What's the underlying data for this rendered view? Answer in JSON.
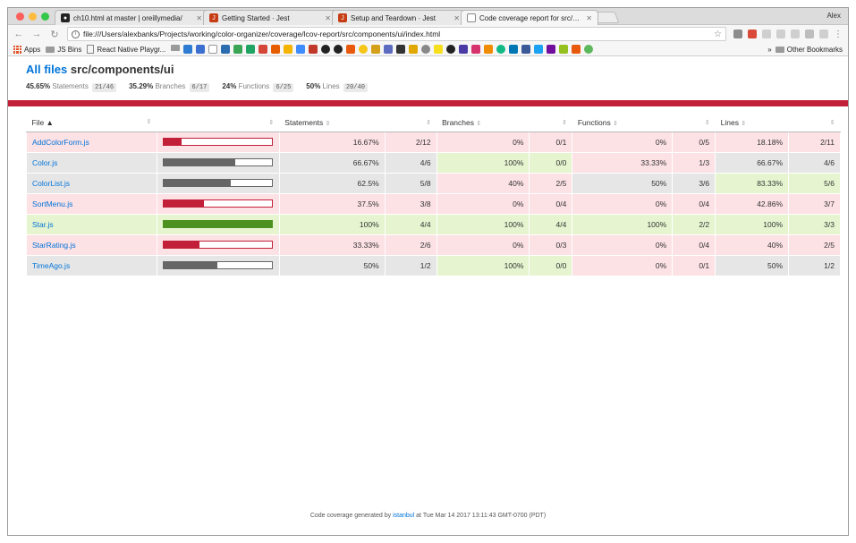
{
  "browser": {
    "user": "Alex",
    "tabs": [
      {
        "title": "ch10.html at master | oreillymedia/",
        "favicon": "github-icon"
      },
      {
        "title": "Getting Started · Jest",
        "favicon": "jest-icon"
      },
      {
        "title": "Setup and Teardown · Jest",
        "favicon": "jest-icon"
      },
      {
        "title": "Code coverage report for src/components/ui",
        "favicon": "page-icon"
      }
    ],
    "url": "file:///Users/alexbanks/Projects/working/color-organizer/coverage/lcov-report/src/components/ui/index.html",
    "bookmarks": {
      "apps": "Apps",
      "js_bins": "JS Bins",
      "react_native": "React Native Playgr...",
      "other": "Other Bookmarks",
      "overflow": "»"
    }
  },
  "report": {
    "all_files_link": "All files",
    "path": "src/components/ui",
    "summary": [
      {
        "pct": "45.65%",
        "label": "Statements",
        "fraction": "21/46"
      },
      {
        "pct": "35.29%",
        "label": "Branches",
        "fraction": "6/17"
      },
      {
        "pct": "24%",
        "label": "Functions",
        "fraction": "6/25"
      },
      {
        "pct": "50%",
        "label": "Lines",
        "fraction": "20/40"
      }
    ],
    "headers": {
      "file": "File ▲",
      "statements": "Statements",
      "branches": "Branches",
      "functions": "Functions",
      "lines": "Lines",
      "sorter": "⇕"
    },
    "rows": [
      {
        "file": "AddColorForm.js",
        "coverage": 0.1667,
        "level": "low",
        "statements": "16.67%",
        "statements_frac": "2/12",
        "statements_level": "low",
        "branches": "0%",
        "branches_frac": "0/1",
        "branches_level": "low",
        "functions": "0%",
        "functions_frac": "0/5",
        "functions_level": "low",
        "lines": "18.18%",
        "lines_frac": "2/11",
        "lines_level": "low"
      },
      {
        "file": "Color.js",
        "coverage": 0.6667,
        "level": "medium",
        "statements": "66.67%",
        "statements_frac": "4/6",
        "statements_level": "medium",
        "branches": "100%",
        "branches_frac": "0/0",
        "branches_level": "high",
        "functions": "33.33%",
        "functions_frac": "1/3",
        "functions_level": "low",
        "lines": "66.67%",
        "lines_frac": "4/6",
        "lines_level": "medium"
      },
      {
        "file": "ColorList.js",
        "coverage": 0.625,
        "level": "medium",
        "statements": "62.5%",
        "statements_frac": "5/8",
        "statements_level": "medium",
        "branches": "40%",
        "branches_frac": "2/5",
        "branches_level": "low",
        "functions": "50%",
        "functions_frac": "3/6",
        "functions_level": "medium",
        "lines": "83.33%",
        "lines_frac": "5/6",
        "lines_level": "high"
      },
      {
        "file": "SortMenu.js",
        "coverage": 0.375,
        "level": "low",
        "statements": "37.5%",
        "statements_frac": "3/8",
        "statements_level": "low",
        "branches": "0%",
        "branches_frac": "0/4",
        "branches_level": "low",
        "functions": "0%",
        "functions_frac": "0/4",
        "functions_level": "low",
        "lines": "42.86%",
        "lines_frac": "3/7",
        "lines_level": "low"
      },
      {
        "file": "Star.js",
        "coverage": 1.0,
        "level": "high",
        "statements": "100%",
        "statements_frac": "4/4",
        "statements_level": "high",
        "branches": "100%",
        "branches_frac": "4/4",
        "branches_level": "high",
        "functions": "100%",
        "functions_frac": "2/2",
        "functions_level": "high",
        "lines": "100%",
        "lines_frac": "3/3",
        "lines_level": "high"
      },
      {
        "file": "StarRating.js",
        "coverage": 0.3333,
        "level": "low",
        "statements": "33.33%",
        "statements_frac": "2/6",
        "statements_level": "low",
        "branches": "0%",
        "branches_frac": "0/3",
        "branches_level": "low",
        "functions": "0%",
        "functions_frac": "0/4",
        "functions_level": "low",
        "lines": "40%",
        "lines_frac": "2/5",
        "lines_level": "low"
      },
      {
        "file": "TimeAgo.js",
        "coverage": 0.5,
        "level": "medium",
        "statements": "50%",
        "statements_frac": "1/2",
        "statements_level": "medium",
        "branches": "100%",
        "branches_frac": "0/0",
        "branches_level": "high",
        "functions": "0%",
        "functions_frac": "0/1",
        "functions_level": "low",
        "lines": "50%",
        "lines_frac": "1/2",
        "lines_level": "medium"
      }
    ],
    "footer": {
      "prefix": "Code coverage generated by",
      "tool": "istanbul",
      "suffix": "at Tue Mar 14 2017 13:11:43 GMT-0700 (PDT)"
    }
  },
  "colors": {
    "low_bg": "#fce1e5",
    "medium_bg": "#e6e6e6",
    "high_bg": "#e6f5d0",
    "low_bar": "#c21f39",
    "medium_bar": "#666666",
    "high_bar": "#4d9221",
    "link": "#0074d9"
  }
}
